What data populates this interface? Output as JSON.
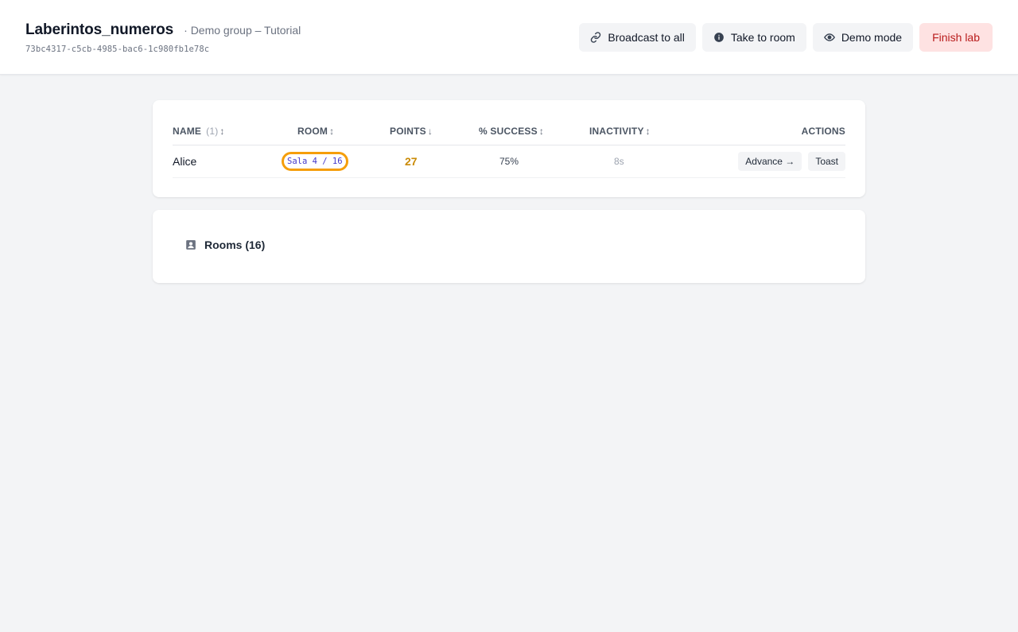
{
  "header": {
    "title": "Laberintos_numeros",
    "subtitle": "· Demo group – Tutorial",
    "lab_id": "73bc4317-c5cb-4985-bac6-1c980fb1e78c",
    "actions": {
      "broadcast_label": "Broadcast to all",
      "take_to_room_label": "Take to room",
      "demo_mode_label": "Demo mode",
      "finish_label": "Finish lab"
    },
    "icons": {
      "broadcast": "link-icon",
      "take_to_room": "info-circle-icon",
      "demo_mode": "eye-icon"
    }
  },
  "students_table": {
    "columns": {
      "name": "Name",
      "name_count": "(1)",
      "room": "Room",
      "points": "Points",
      "success": "% Success",
      "inactivity": "Inactivity",
      "actions": "Actions"
    },
    "sort_icons": {
      "name": "↕",
      "room": "↕",
      "points": "↓",
      "success": "↕",
      "inactivity": "↕"
    },
    "rows": [
      {
        "name": "Alice",
        "room": "Sala 4 / 16",
        "points": "27",
        "success": "75%",
        "inactivity": "8s",
        "advance_label": "Advance →",
        "toast_label": "Toast"
      }
    ]
  },
  "rooms_panel": {
    "label": "Rooms (16)",
    "icon": "user-square-icon"
  },
  "colors": {
    "points": "#ca8a04",
    "room_highlight": "#f59e0b",
    "room_text": "#4338ca",
    "finish_bg": "#fee2e2",
    "finish_text": "#b91c1c"
  }
}
